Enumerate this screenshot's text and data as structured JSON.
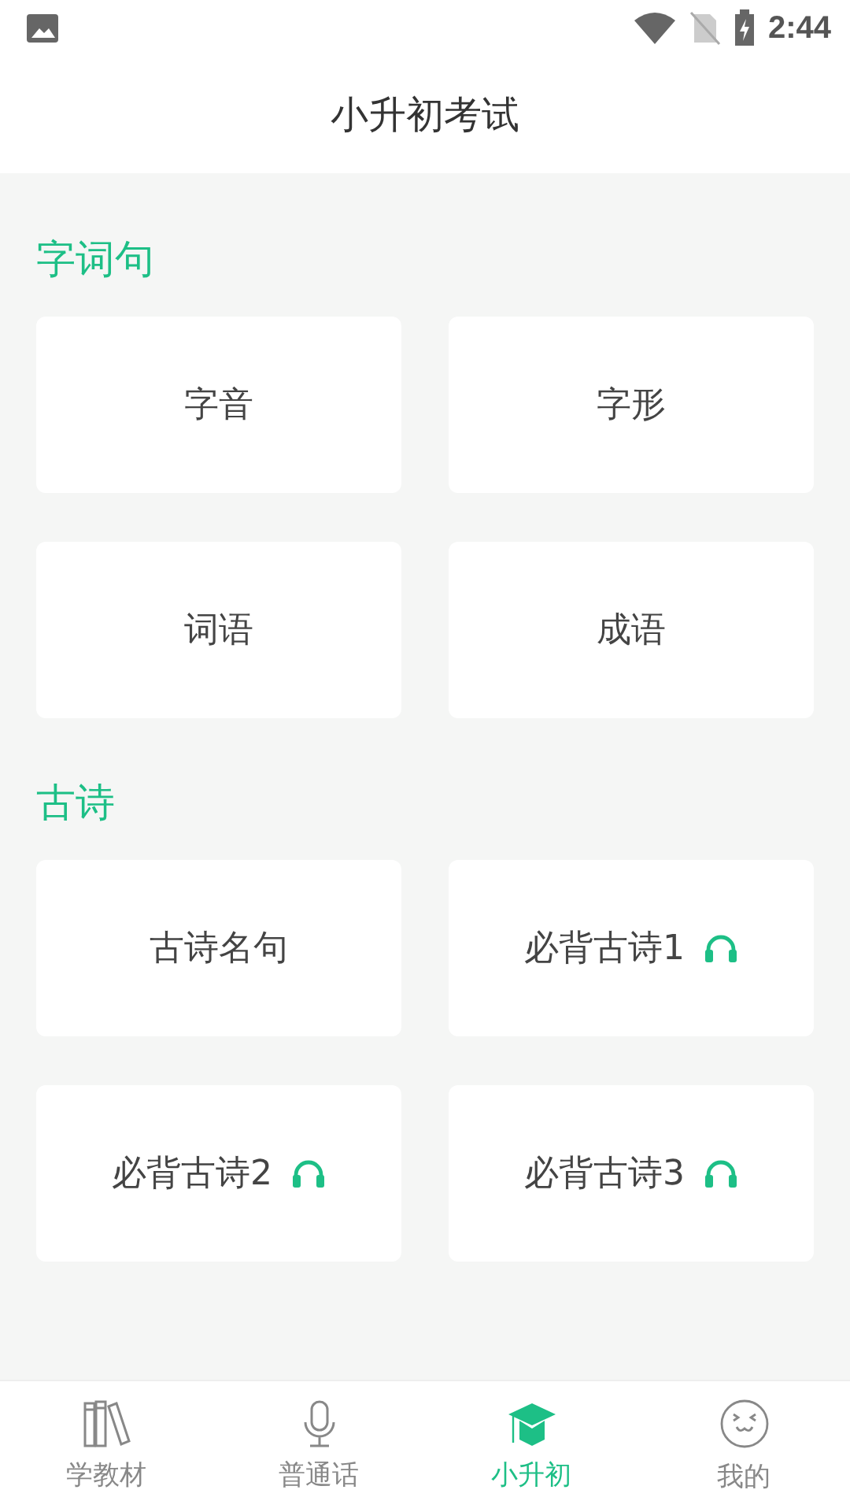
{
  "status_bar": {
    "time": "2:44"
  },
  "header": {
    "title": "小升初考试"
  },
  "sections": [
    {
      "title": "字词句",
      "items": [
        {
          "label": "字音",
          "audio": false
        },
        {
          "label": "字形",
          "audio": false
        },
        {
          "label": "词语",
          "audio": false
        },
        {
          "label": "成语",
          "audio": false
        }
      ]
    },
    {
      "title": "古诗",
      "items": [
        {
          "label": "古诗名句",
          "audio": false
        },
        {
          "label": "必背古诗1",
          "audio": true
        },
        {
          "label": "必背古诗2",
          "audio": true
        },
        {
          "label": "必背古诗3",
          "audio": true
        }
      ]
    }
  ],
  "bottom_nav": [
    {
      "kind": "books",
      "label": "学教材",
      "selected": false
    },
    {
      "kind": "mic",
      "label": "普通话",
      "selected": false
    },
    {
      "kind": "cap",
      "label": "小升初",
      "selected": true
    },
    {
      "kind": "face",
      "label": "我的",
      "selected": false
    }
  ]
}
